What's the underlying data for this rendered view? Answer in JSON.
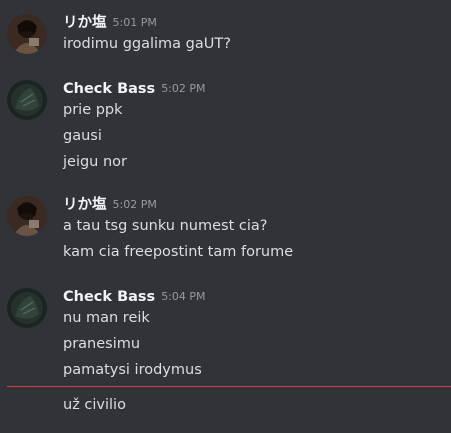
{
  "messages": [
    {
      "author": "リか塩",
      "time": "5:01 PM",
      "lines": [
        "irodimu ggalima gaUT?"
      ]
    },
    {
      "author": "Check Bass",
      "time": "5:02 PM",
      "lines": [
        "prie ppk",
        "gausi",
        "jeigu nor"
      ]
    },
    {
      "author": "リか塩",
      "time": "5:02 PM",
      "lines": [
        "a tau tsg sunku numest cia?",
        "kam cia freepostint tam forume"
      ]
    },
    {
      "author": "Check Bass",
      "time": "5:04 PM",
      "lines": [
        "nu man reik",
        "pranesimu",
        "pamatysi irodymus"
      ]
    }
  ],
  "after_divider": {
    "lines": [
      "už civilio"
    ]
  },
  "colors": {
    "background": "#313338",
    "author": "#f2f3f5",
    "message_text": "#dbdee1",
    "timestamp": "#949ba4",
    "new_messages_divider": "#d83c3e"
  }
}
